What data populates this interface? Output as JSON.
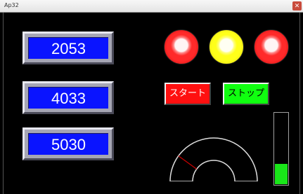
{
  "window": {
    "title": "Ap32",
    "close_glyph": "✕"
  },
  "displays": [
    {
      "value": "2053"
    },
    {
      "value": "4033"
    },
    {
      "value": "5030"
    }
  ],
  "lamps": [
    {
      "color": "red"
    },
    {
      "color": "yellow"
    },
    {
      "color": "red"
    }
  ],
  "buttons": {
    "start_label": "スタート",
    "stop_label": "ストップ"
  },
  "gauge": {
    "min": 0,
    "max": 100,
    "value": 20,
    "needle_color": "#cc0000"
  },
  "level_bar": {
    "fraction": 0.28,
    "color": "#19e619"
  }
}
